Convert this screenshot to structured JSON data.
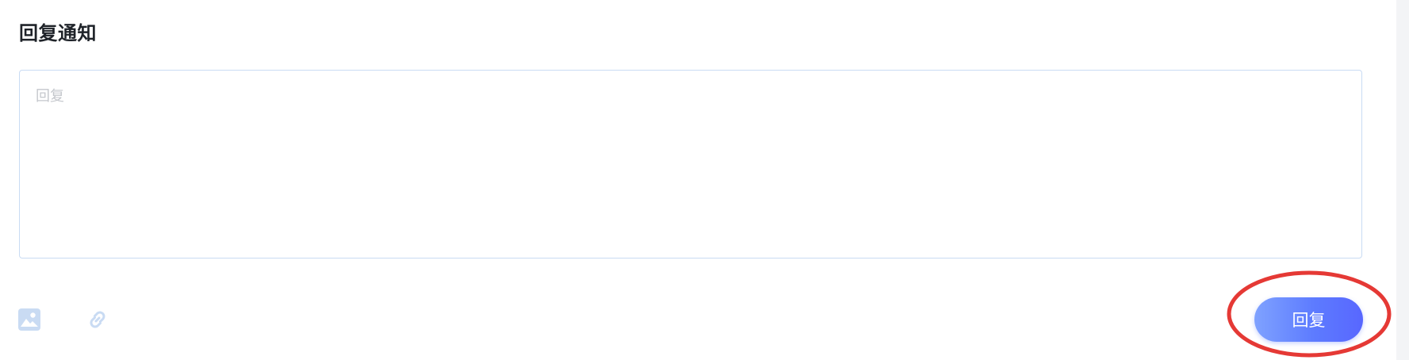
{
  "header": {
    "title": "回复通知"
  },
  "reply": {
    "placeholder": "回复",
    "value": ""
  },
  "toolbar": {
    "icons": [
      {
        "name": "image-icon"
      },
      {
        "name": "link-icon"
      }
    ]
  },
  "actions": {
    "reply_label": "回复"
  },
  "colors": {
    "accent": "#5d7bff",
    "border": "#c9dbf3",
    "icon": "#c9dbf3",
    "annotation": "#e53935"
  }
}
